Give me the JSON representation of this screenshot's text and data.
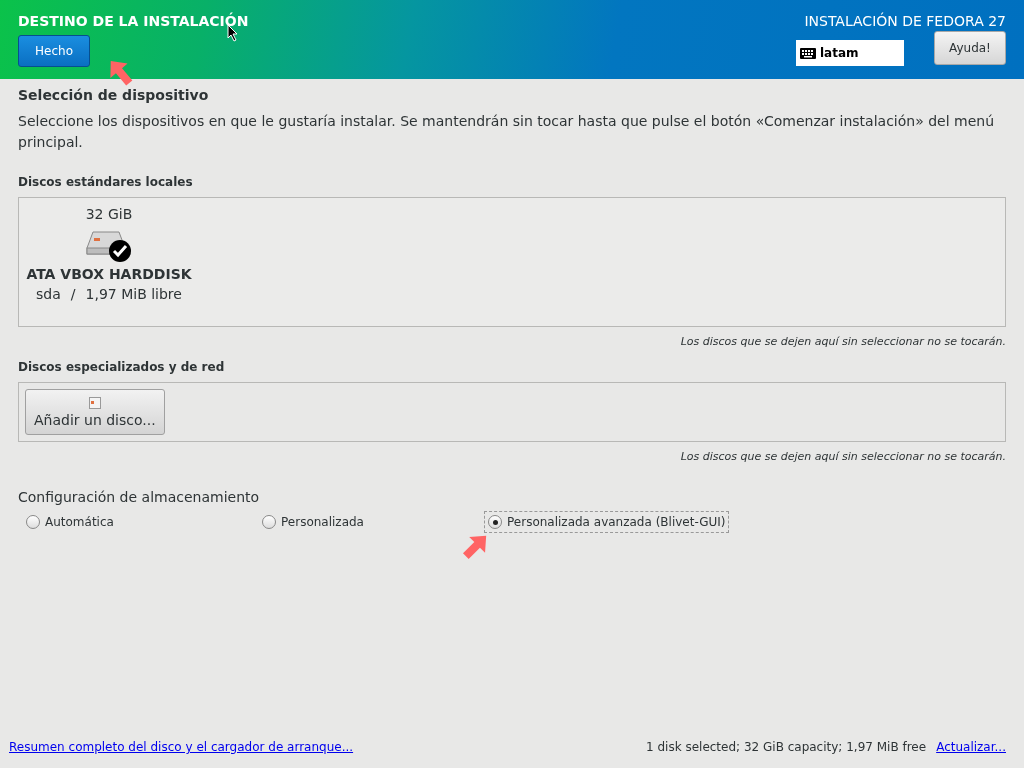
{
  "header": {
    "title": "DESTINO DE LA INSTALACIÓN",
    "done_button": "Hecho",
    "product": "INSTALACIÓN DE FEDORA 27",
    "keyboard_layout": "latam",
    "help_button": "Ayuda!"
  },
  "device_selection": {
    "heading": "Selección de dispositivo",
    "description": "Seleccione los dispositivos en que le gustaría instalar. Se mantendrán sin tocar hasta que pulse el botón «Comenzar instalación» del menú principal."
  },
  "local_disks": {
    "heading": "Discos estándares locales",
    "disks": [
      {
        "size": "32 GiB",
        "name": "ATA VBOX HARDDISK",
        "device": "sda",
        "separator": "/",
        "free": "1,97 MiB libre",
        "selected": true
      }
    ],
    "note": "Los discos que se dejen aquí sin seleccionar no se tocarán."
  },
  "network_disks": {
    "heading": "Discos especializados y de red",
    "add_button": "Añadir un disco...",
    "note": "Los discos que se dejen aquí sin seleccionar no se tocarán."
  },
  "storage_config": {
    "heading": "Configuración de almacenamiento",
    "options": [
      {
        "label": "Automática",
        "selected": false
      },
      {
        "label": "Personalizada",
        "selected": false
      },
      {
        "label": "Personalizada avanzada (Blivet-GUI)",
        "selected": true
      }
    ]
  },
  "footer": {
    "summary_link": "Resumen completo del disco y el cargador de arranque...",
    "status": "1 disk selected; 32 GiB capacity; 1,97 MiB free",
    "refresh_link": "Actualizar..."
  }
}
